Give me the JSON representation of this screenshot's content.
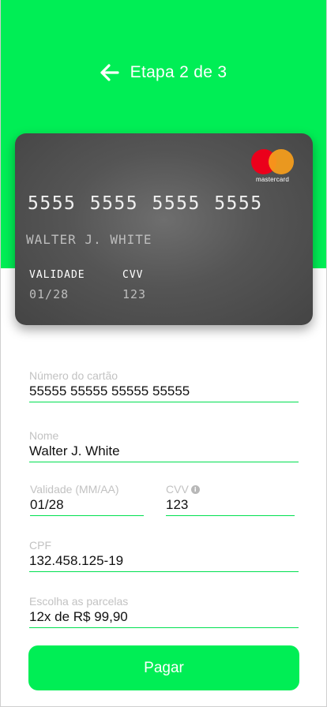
{
  "header": {
    "title": "Etapa 2 de 3",
    "back_icon": "arrow-left-icon"
  },
  "card": {
    "brand": "mastercard",
    "number": "5555 5555 5555 5555",
    "holder": "WALTER J. WHITE",
    "expiry_label": "VALIDADE",
    "expiry": "01/28",
    "cvv_label": "CVV",
    "cvv": "123"
  },
  "form": {
    "card_number": {
      "label": "Número do cartão",
      "value": "55555 55555 55555 55555"
    },
    "name": {
      "label": "Nome",
      "value": "Walter J. White"
    },
    "expiry": {
      "label": "Validade (MM/AA)",
      "value": "01/28"
    },
    "cvv": {
      "label": "CVV",
      "value": "123",
      "icon": "info-icon"
    },
    "cpf": {
      "label": "CPF",
      "value": "132.458.125-19"
    },
    "installments": {
      "label": "Escolha as parcelas",
      "value": "12x de R$ 99,90"
    }
  },
  "actions": {
    "pay_label": "Pagar"
  },
  "colors": {
    "accent": "#00ee55",
    "card_bg": "#555555",
    "input_line": "#00e050",
    "label": "#c2c2c2"
  }
}
